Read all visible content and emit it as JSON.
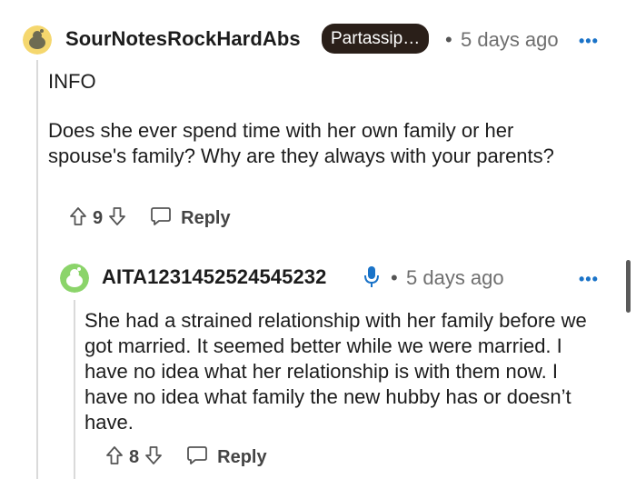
{
  "comment": {
    "username": "SourNotesRockHardAbs",
    "flair": "Partassip…",
    "separator": "•",
    "time": "5 days ago",
    "more": "•••",
    "body": [
      "INFO",
      "Does she ever spend time with her own family or her spouse's family? Why are they always with your parents?"
    ],
    "votes": "9",
    "reply_label": "Reply",
    "avatar_color": "#f5d76e"
  },
  "reply": {
    "username": "AITA1231452524545232",
    "separator": "•",
    "time": "5 days ago",
    "more": "•••",
    "body": "She had a strained relationship with her family before we got married. It seemed better while we were married. I have no idea what her relationship is with them now. I have no idea what family the new hubby has or doesn’t have.",
    "votes": "8",
    "reply_label": "Reply",
    "avatar_color": "#8bd46a",
    "op_badge_color": "#1a73c8"
  }
}
